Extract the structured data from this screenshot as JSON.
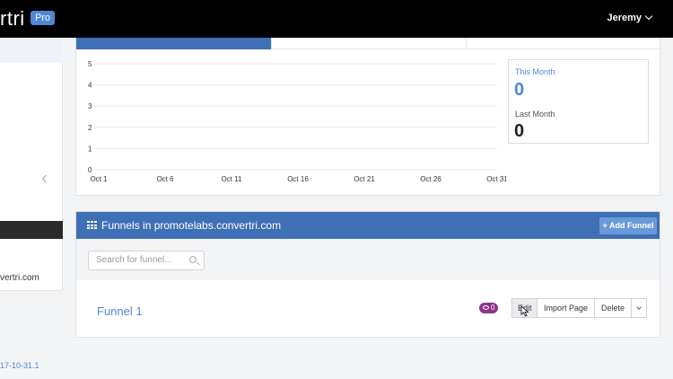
{
  "header": {
    "brand": "rtri",
    "badge": "Pro",
    "user": "Jeremy"
  },
  "sidebar": {
    "domain_text": "vertri.com",
    "version_text": "17-10-31.1"
  },
  "chart_data": {
    "type": "line",
    "title": "",
    "xlabel": "",
    "ylabel": "",
    "x_ticks": [
      "Oct 1",
      "Oct 6",
      "Oct 11",
      "Oct 16",
      "Oct 21",
      "Oct 26",
      "Oct 31"
    ],
    "y_ticks": [
      0,
      1,
      2,
      3,
      4,
      5
    ],
    "ylim": [
      0,
      5
    ],
    "series": [
      {
        "values": [
          0,
          0,
          0,
          0,
          0,
          0,
          0
        ]
      }
    ],
    "grid": true
  },
  "stats": {
    "this_month_label": "This Month",
    "this_month_value": "0",
    "last_month_label": "Last Month",
    "last_month_value": "0"
  },
  "funnels": {
    "title": "Funnels in promotelabs.convertri.com",
    "add_button": "+ Add Funnel",
    "search_placeholder": "Search for funnel...",
    "items": [
      {
        "name": "Funnel 1",
        "views": "0",
        "actions": {
          "edit": "Edit",
          "import": "Import Page",
          "delete": "Delete"
        }
      }
    ]
  },
  "colors": {
    "primary": "#3f6fb5",
    "accent": "#4f86d6",
    "badge": "#8e3390"
  }
}
